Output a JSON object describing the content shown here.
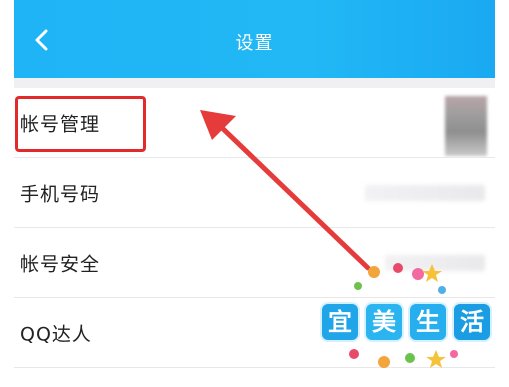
{
  "header": {
    "title": "设置",
    "back_icon": "chevron-left-icon"
  },
  "settings": {
    "items": [
      {
        "label": "帐号管理"
      },
      {
        "label": "手机号码"
      },
      {
        "label": "帐号安全"
      },
      {
        "label": "QQ达人"
      }
    ]
  },
  "annotation": {
    "highlight_color": "#e32a2a",
    "arrow_color": "#e53b3b"
  },
  "watermark": {
    "text": "宜美生活"
  },
  "colors": {
    "header_bg": "#1eb4f6",
    "page_bg": "#ffffff",
    "gap_bg": "#f0f0f2"
  }
}
